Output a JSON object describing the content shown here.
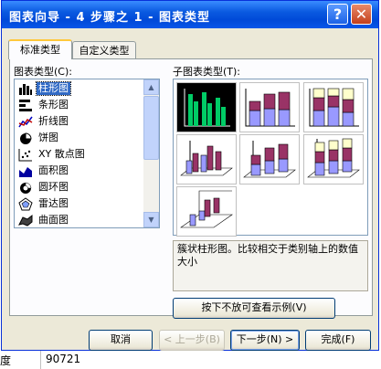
{
  "sheet": {
    "cell_a": "度",
    "cell_b": "90721"
  },
  "window": {
    "title": "图表向导 - 4 步骤之 1 - 图表类型",
    "help_glyph": "?",
    "close_glyph": "✕"
  },
  "tabs": [
    {
      "label": "标准类型",
      "active": true
    },
    {
      "label": "自定义类型",
      "active": false
    }
  ],
  "chart_type_label": "图表类型(C):",
  "chart_types": [
    {
      "label": "柱形图",
      "icon": "column-chart-icon",
      "selected": true
    },
    {
      "label": "条形图",
      "icon": "bar-chart-icon",
      "selected": false
    },
    {
      "label": "折线图",
      "icon": "line-chart-icon",
      "selected": false
    },
    {
      "label": "饼图",
      "icon": "pie-chart-icon",
      "selected": false
    },
    {
      "label": "XY 散点图",
      "icon": "scatter-chart-icon",
      "selected": false
    },
    {
      "label": "面积图",
      "icon": "area-chart-icon",
      "selected": false
    },
    {
      "label": "圆环图",
      "icon": "doughnut-chart-icon",
      "selected": false
    },
    {
      "label": "雷达图",
      "icon": "radar-chart-icon",
      "selected": false
    },
    {
      "label": "曲面图",
      "icon": "surface-chart-icon",
      "selected": false
    }
  ],
  "subtype_label": "子图表类型(T):",
  "subtypes": [
    {
      "name": "clustered-column",
      "selected": true
    },
    {
      "name": "stacked-column",
      "selected": false
    },
    {
      "name": "percent-stacked-column",
      "selected": false
    },
    {
      "name": "3d-clustered-column",
      "selected": false
    },
    {
      "name": "3d-stacked-column",
      "selected": false
    },
    {
      "name": "3d-percent-stacked-column",
      "selected": false
    },
    {
      "name": "3d-column",
      "selected": false
    }
  ],
  "description": "簇状柱形图。比较相交于类别轴上的数值大小",
  "preview_button": "按下不放可查看示例(V)",
  "buttons": {
    "cancel": "取消",
    "back": "< 上一步(B)",
    "next": "下一步(N) >",
    "finish": "完成(F)"
  },
  "colors": {
    "titlebar": "#0a5ae0",
    "selection": "#316ac5",
    "series_blue": "#9999ff",
    "series_purple": "#993366",
    "series_cream": "#ffffcc",
    "series_green": "#00cc66"
  }
}
